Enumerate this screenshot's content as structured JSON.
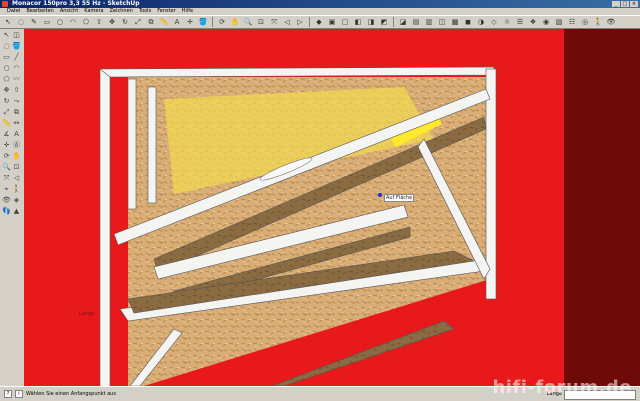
{
  "window": {
    "title": "Monacor 150pro 3,3 55 Hz - SketchUp"
  },
  "menu": [
    "Datei",
    "Bearbeiten",
    "Ansicht",
    "Kamera",
    "Zeichnen",
    "Tools",
    "Fenster",
    "Hilfe"
  ],
  "toolbar": {
    "icons": [
      "select-icon",
      "eraser-icon",
      "pencil-icon",
      "rectangle-icon",
      "circle-icon",
      "arc-icon",
      "polygon-icon",
      "pushpull-icon",
      "move-icon",
      "rotate-icon",
      "scale-icon",
      "offset-icon",
      "tape-icon",
      "text-icon",
      "axes-icon",
      "paint-icon",
      "orbit-icon",
      "pan-icon",
      "zoom-icon",
      "zoom-window-icon",
      "zoom-extents-icon",
      "previous-view-icon",
      "next-view-icon",
      "iso-view-icon",
      "top-view-icon",
      "front-view-icon",
      "right-view-icon",
      "back-view-icon",
      "left-view-icon",
      "xray-icon",
      "wireframe-icon",
      "hidden-line-icon",
      "shaded-icon",
      "textured-icon",
      "monochrome-icon",
      "section-icon",
      "shadows-icon",
      "layers-icon",
      "components-icon",
      "materials-icon",
      "styles-icon",
      "scenes-icon",
      "camera-icon",
      "walk-icon",
      "look-icon",
      "position-icon"
    ]
  },
  "viewport": {
    "tooltip": "Auf Fläche",
    "dimension_label": "Länge"
  },
  "status": {
    "message": "Wählen Sie einen Anfangspunkt aus",
    "measure_label": "Länge",
    "measure_value": ""
  },
  "watermark": "hifi-forum.de",
  "colors": {
    "background": "#e8191a",
    "board": "#dcb27a",
    "frame": "#f4f4f2",
    "highlight": "#ffe23a"
  }
}
